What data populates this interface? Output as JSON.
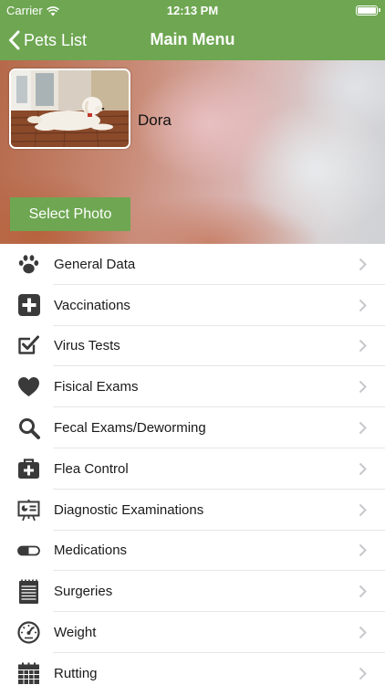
{
  "status_bar": {
    "carrier": "Carrier",
    "time": "12:13 PM"
  },
  "nav": {
    "back_label": "Pets List",
    "title": "Main Menu"
  },
  "pet": {
    "name": "Dora",
    "select_photo_label": "Select Photo"
  },
  "colors": {
    "accent": "#6ea651",
    "icon": "#3a3a3a",
    "chevron": "#c7c7cc",
    "separator": "#e6e6e6"
  },
  "menu": [
    {
      "label": "General Data",
      "icon": "paw-icon"
    },
    {
      "label": "Vaccinations",
      "icon": "medical-cross-icon"
    },
    {
      "label": "Virus Tests",
      "icon": "checkbox-icon"
    },
    {
      "label": "Fisical Exams",
      "icon": "heart-icon"
    },
    {
      "label": "Fecal Exams/Deworming",
      "icon": "magnifier-icon"
    },
    {
      "label": "Flea Control",
      "icon": "first-aid-kit-icon"
    },
    {
      "label": "Diagnostic Examinations",
      "icon": "presentation-board-icon"
    },
    {
      "label": "Medications",
      "icon": "pill-capsule-icon"
    },
    {
      "label": "Surgeries",
      "icon": "notepad-icon"
    },
    {
      "label": "Weight",
      "icon": "gauge-icon"
    },
    {
      "label": "Rutting",
      "icon": "calendar-icon"
    }
  ]
}
